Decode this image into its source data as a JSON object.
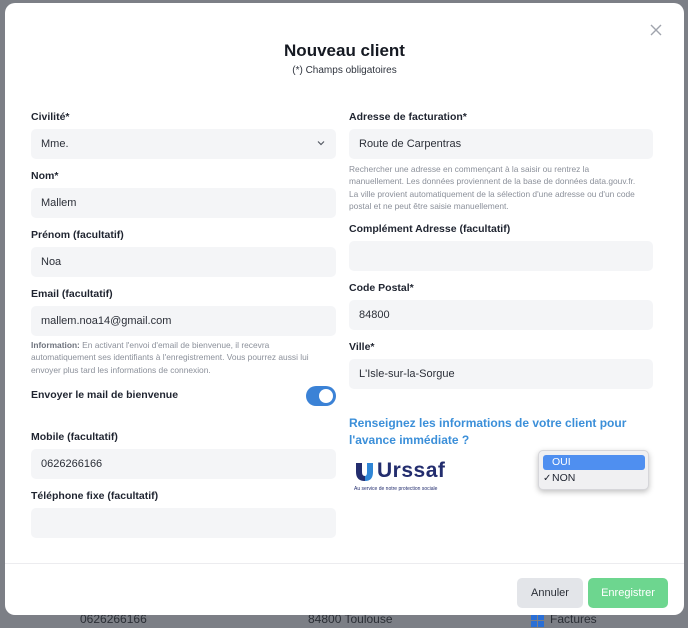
{
  "modal": {
    "title": "Nouveau client",
    "subtitle": "(*) Champs obligatoires",
    "close_icon": "close-icon"
  },
  "left": {
    "civilite_label": "Civilité*",
    "civilite_value": "Mme.",
    "nom_label": "Nom*",
    "nom_value": "Mallem",
    "prenom_label": "Prénom (facultatif)",
    "prenom_value": "Noa",
    "email_label": "Email (facultatif)",
    "email_value": "mallem.noa14@gmail.com",
    "info_bold": "Information:",
    "info_text": " En activant l'envoi d'email de bienvenue, il recevra automatiquement ses identifiants à l'enregistrement. Vous pourrez aussi lui envoyer plus tard les informations de connexion.",
    "welcome_label": "Envoyer le mail de bienvenue",
    "welcome_on": true,
    "mobile_label": "Mobile (facultatif)",
    "mobile_value": "0626266166",
    "fixe_label": "Téléphone fixe (facultatif)",
    "fixe_value": ""
  },
  "right": {
    "adresse_label": "Adresse de facturation*",
    "adresse_value": "Route de Carpentras",
    "adresse_hint": "Rechercher une adresse en commençant à la saisir ou rentrez la manuellement. Les données proviennent de la base de données data.gouv.fr. La ville provient automatiquement de la sélection d'une adresse ou d'un code postal et ne peut être saisie manuellement.",
    "complement_label": "Complément Adresse (facultatif)",
    "complement_value": "",
    "cp_label": "Code Postal*",
    "cp_value": "84800",
    "ville_label": "Ville*",
    "ville_value": "L'Isle-sur-la-Sorgue",
    "avance_link": "Renseignez les informations de votre client pour l'avance immédiate ?",
    "urssaf_logo": "Urssaf",
    "urssaf_tagline": "Au service de notre protection sociale",
    "select_options": [
      "OUI",
      "NON"
    ],
    "select_highlighted": "OUI",
    "select_checked": "NON"
  },
  "footer": {
    "cancel": "Annuler",
    "save": "Enregistrer"
  },
  "background": {
    "text1": "0626266166",
    "text2": "84800 Toulouse",
    "text3": "Factures"
  },
  "colors": {
    "accent": "#3b82d6",
    "link": "#3b8fd9",
    "save": "#6dd68f",
    "urssaf": "#232d6e"
  }
}
